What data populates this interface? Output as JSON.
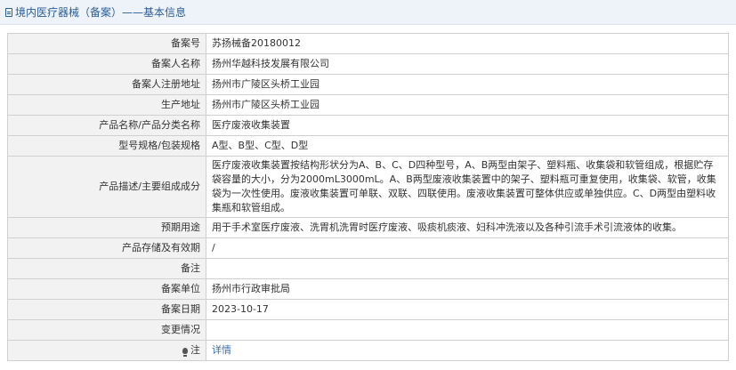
{
  "header": {
    "title": "境内医疗器械（备案）——基本信息"
  },
  "rows": [
    {
      "label": "备案号",
      "value": "苏扬械备20180012"
    },
    {
      "label": "备案人名称",
      "value": "扬州华越科技发展有限公司"
    },
    {
      "label": "备案人注册地址",
      "value": "扬州市广陵区头桥工业园"
    },
    {
      "label": "生产地址",
      "value": "扬州市广陵区头桥工业园"
    },
    {
      "label": "产品名称/产品分类名称",
      "value": "医疗废液收集装置"
    },
    {
      "label": "型号规格/包装规格",
      "value": "A型、B型、C型、D型"
    },
    {
      "label": "产品描述/主要组成成分",
      "value": "医疗废液收集装置按结构形状分为A、B、C、D四种型号，A、B两型由架子、塑料瓶、收集袋和软管组成，根据贮存袋容量的大小，分为2000mL3000mL。A、B两型废液收集装置中的架子、塑料瓶可重复使用，收集袋、软管，收集袋为一次性使用。废液收集装置可单联、双联、四联使用。废液收集装置可整体供应或单独供应。C、D两型由塑料收集瓶和软管组成。"
    },
    {
      "label": "预期用途",
      "value": "用于手术室医疗废液、洗胃机洗胃时医疗废液、吸痰机痰液、妇科冲洗液以及各种引流手术引流液体的收集。"
    },
    {
      "label": "产品存储及有效期",
      "value": "/"
    },
    {
      "label": "备注",
      "value": ""
    },
    {
      "label": "备案单位",
      "value": "扬州市行政审批局"
    },
    {
      "label": "备案日期",
      "value": "2023-10-17"
    },
    {
      "label": "变更情况",
      "value": ""
    },
    {
      "label": "注",
      "value": "详情"
    }
  ],
  "icons": {
    "header": "document-icon",
    "note": "lightbulb-icon"
  }
}
